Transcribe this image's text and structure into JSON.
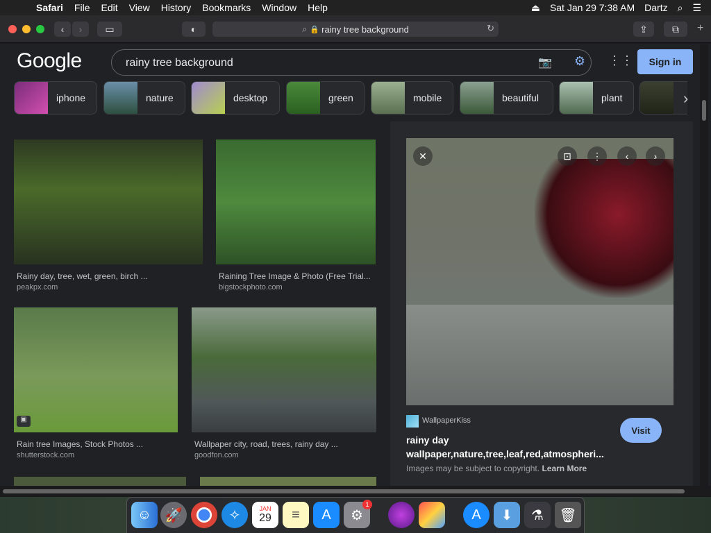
{
  "menubar": {
    "app": "Safari",
    "items": [
      "File",
      "Edit",
      "View",
      "History",
      "Bookmarks",
      "Window",
      "Help"
    ],
    "clock": "Sat Jan 29  7:38 AM",
    "user": "Dartz"
  },
  "browser": {
    "url": "rainy tree background"
  },
  "google": {
    "logo": "Google",
    "query": "rainy tree background",
    "signin": "Sign in"
  },
  "chips": [
    "iphone",
    "nature",
    "desktop",
    "green",
    "mobile",
    "beautiful",
    "plant"
  ],
  "results": [
    {
      "title": "Rainy day, tree, wet, green, birch ...",
      "source": "peakpx.com"
    },
    {
      "title": "Raining Tree Image & Photo (Free Trial...",
      "source": "bigstockphoto.com"
    },
    {
      "title": "Rain tree Images, Stock Photos ...",
      "source": "shutterstock.com"
    },
    {
      "title": "Wallpaper city, road, trees, rainy day ...",
      "source": "goodfon.com"
    }
  ],
  "preview": {
    "source_name": "WallpaperKiss",
    "title_line1": "rainy day",
    "title_line2": "wallpaper,nature,tree,leaf,red,atmospheri...",
    "visit": "Visit",
    "copyright": "Images may be subject to copyright.",
    "learn_more": "Learn More"
  },
  "dock": {
    "calendar_month": "JAN",
    "calendar_day": "29",
    "badge": "1"
  },
  "colors": {
    "accent": "#8ab4f8",
    "bg": "#202124"
  }
}
